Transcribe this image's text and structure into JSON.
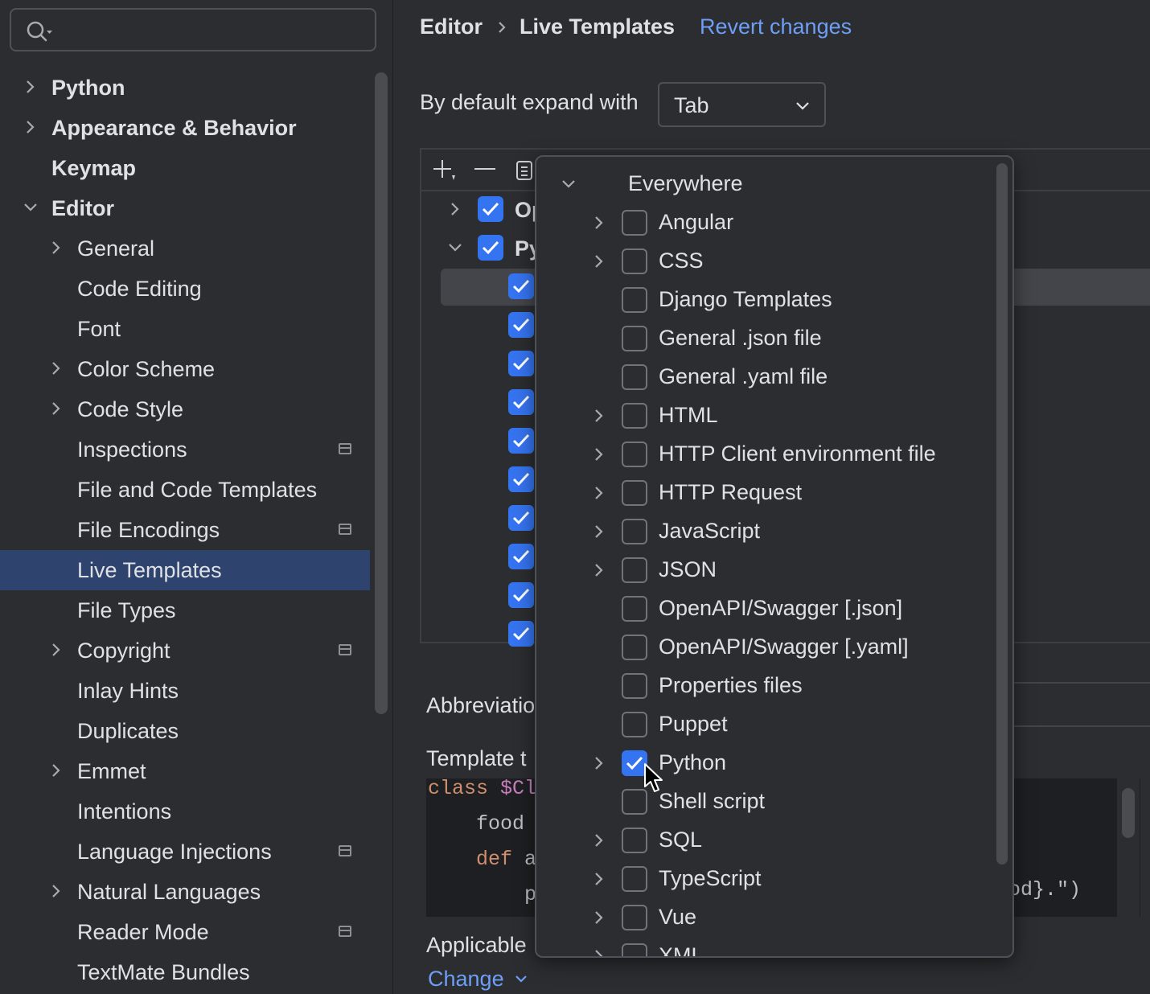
{
  "search": {
    "placeholder": "",
    "value": ""
  },
  "sidebar": {
    "items": [
      {
        "label": "Python",
        "level": 0,
        "expandable": true,
        "expanded": false,
        "bold": true
      },
      {
        "label": "Appearance & Behavior",
        "level": 0,
        "expandable": true,
        "expanded": false,
        "bold": true
      },
      {
        "label": "Keymap",
        "level": 0,
        "expandable": false,
        "bold": true
      },
      {
        "label": "Editor",
        "level": 0,
        "expandable": true,
        "expanded": true,
        "bold": true
      },
      {
        "label": "General",
        "level": 1,
        "expandable": true,
        "expanded": false
      },
      {
        "label": "Code Editing",
        "level": 1,
        "expandable": false
      },
      {
        "label": "Font",
        "level": 1,
        "expandable": false
      },
      {
        "label": "Color Scheme",
        "level": 1,
        "expandable": true,
        "expanded": false
      },
      {
        "label": "Code Style",
        "level": 1,
        "expandable": true,
        "expanded": false
      },
      {
        "label": "Inspections",
        "level": 1,
        "expandable": false,
        "project_icon": true
      },
      {
        "label": "File and Code Templates",
        "level": 1,
        "expandable": false
      },
      {
        "label": "File Encodings",
        "level": 1,
        "expandable": false,
        "project_icon": true
      },
      {
        "label": "Live Templates",
        "level": 1,
        "expandable": false,
        "selected": true
      },
      {
        "label": "File Types",
        "level": 1,
        "expandable": false
      },
      {
        "label": "Copyright",
        "level": 1,
        "expandable": true,
        "expanded": false,
        "project_icon": true
      },
      {
        "label": "Inlay Hints",
        "level": 1,
        "expandable": false
      },
      {
        "label": "Duplicates",
        "level": 1,
        "expandable": false
      },
      {
        "label": "Emmet",
        "level": 1,
        "expandable": true,
        "expanded": false
      },
      {
        "label": "Intentions",
        "level": 1,
        "expandable": false
      },
      {
        "label": "Language Injections",
        "level": 1,
        "expandable": false,
        "project_icon": true
      },
      {
        "label": "Natural Languages",
        "level": 1,
        "expandable": true,
        "expanded": false
      },
      {
        "label": "Reader Mode",
        "level": 1,
        "expandable": false,
        "project_icon": true
      },
      {
        "label": "TextMate Bundles",
        "level": 1,
        "expandable": false
      }
    ]
  },
  "header": {
    "breadcrumb_parent": "Editor",
    "breadcrumb_current": "Live Templates",
    "revert_link": "Revert changes"
  },
  "expand": {
    "label": "By default expand with",
    "value": "Tab"
  },
  "templates_panel": {
    "toolbar_icons": [
      "add-icon",
      "remove-icon",
      "copy-icon"
    ],
    "groups": [
      {
        "label": "Op",
        "checked": true,
        "expanded": false
      },
      {
        "label": "Py",
        "checked": true,
        "expanded": true
      }
    ],
    "child_rows_checked": [
      true,
      true,
      true,
      true,
      true,
      true,
      true,
      true,
      true,
      true
    ]
  },
  "details": {
    "abbreviation_label": "Abbreviatio",
    "template_text_label": "Template t",
    "code_lines": [
      {
        "text": "class $Cl",
        "tokens": [
          {
            "t": "class ",
            "c": "#cf8e6d"
          },
          {
            "t": "$Cl",
            "c": "#c77dbb"
          }
        ]
      },
      {
        "text": "    food ",
        "tokens": [
          {
            "t": "    food ",
            "c": "#bcbec4"
          }
        ]
      },
      {
        "text": "    def a",
        "tokens": [
          {
            "t": "    def ",
            "c": "#cf8e6d"
          },
          {
            "t": "a",
            "c": "#bcbec4"
          }
        ]
      },
      {
        "text": "        p",
        "tokens": [
          {
            "t": "        p",
            "c": "#bcbec4"
          }
        ]
      }
    ],
    "code_tail": "od}.\")",
    "applicable_label": "Applicable",
    "change_link": "Change"
  },
  "popup": {
    "items": [
      {
        "label": "Everywhere",
        "level": 0,
        "state": "mixed",
        "expandable": true,
        "expanded": true
      },
      {
        "label": "Angular",
        "level": 1,
        "state": "off",
        "expandable": true
      },
      {
        "label": "CSS",
        "level": 1,
        "state": "off",
        "expandable": true
      },
      {
        "label": "Django Templates",
        "level": 1,
        "state": "off",
        "expandable": false
      },
      {
        "label": "General .json file",
        "level": 1,
        "state": "off",
        "expandable": false
      },
      {
        "label": "General .yaml file",
        "level": 1,
        "state": "off",
        "expandable": false
      },
      {
        "label": "HTML",
        "level": 1,
        "state": "off",
        "expandable": true
      },
      {
        "label": "HTTP Client environment file",
        "level": 1,
        "state": "off",
        "expandable": true
      },
      {
        "label": "HTTP Request",
        "level": 1,
        "state": "off",
        "expandable": true
      },
      {
        "label": "JavaScript",
        "level": 1,
        "state": "off",
        "expandable": true
      },
      {
        "label": "JSON",
        "level": 1,
        "state": "off",
        "expandable": true
      },
      {
        "label": "OpenAPI/Swagger [.json]",
        "level": 1,
        "state": "off",
        "expandable": false
      },
      {
        "label": "OpenAPI/Swagger [.yaml]",
        "level": 1,
        "state": "off",
        "expandable": false
      },
      {
        "label": "Properties files",
        "level": 1,
        "state": "off",
        "expandable": false
      },
      {
        "label": "Puppet",
        "level": 1,
        "state": "off",
        "expandable": false
      },
      {
        "label": "Python",
        "level": 1,
        "state": "on",
        "expandable": true
      },
      {
        "label": "Shell script",
        "level": 1,
        "state": "off",
        "expandable": false
      },
      {
        "label": "SQL",
        "level": 1,
        "state": "off",
        "expandable": true
      },
      {
        "label": "TypeScript",
        "level": 1,
        "state": "off",
        "expandable": true
      },
      {
        "label": "Vue",
        "level": 1,
        "state": "off",
        "expandable": true
      },
      {
        "label": "XML",
        "level": 1,
        "state": "off",
        "expandable": true
      }
    ]
  },
  "colors": {
    "accent": "#3574f0",
    "link": "#6e9ff5",
    "selection": "#2e436e",
    "background": "#2b2d30"
  }
}
